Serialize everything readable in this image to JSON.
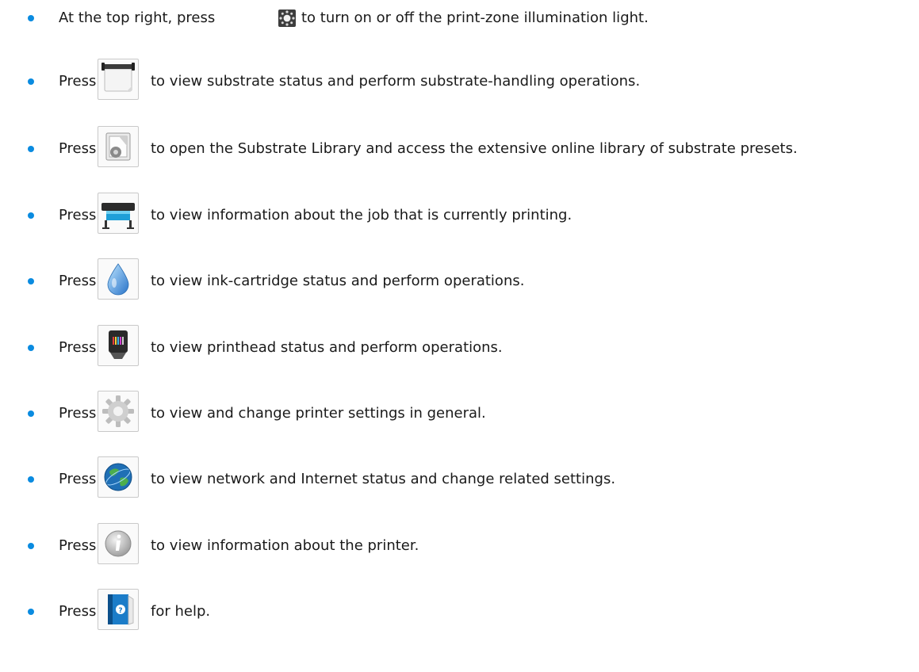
{
  "items": [
    {
      "lead": "At the top right, press",
      "icon": "sun-icon",
      "text": "to turn on or off the print-zone illumination light."
    },
    {
      "lead": "Press",
      "icon": "substrate-roll-icon",
      "text": "to view substrate status and perform substrate-handling operations."
    },
    {
      "lead": "Press",
      "icon": "substrate-library-icon",
      "text": "to open the Substrate Library and access the extensive online library of substrate presets."
    },
    {
      "lead": "Press",
      "icon": "printer-icon",
      "text": "to view information about the job that is currently printing."
    },
    {
      "lead": "Press",
      "icon": "ink-drop-icon",
      "text": "to view ink-cartridge status and perform operations."
    },
    {
      "lead": "Press",
      "icon": "printhead-icon",
      "text": "to view printhead status and perform operations."
    },
    {
      "lead": "Press",
      "icon": "gear-icon",
      "text": "to view and change printer settings in general."
    },
    {
      "lead": "Press",
      "icon": "globe-icon",
      "text": "to view network and Internet status and change related settings."
    },
    {
      "lead": "Press",
      "icon": "info-icon",
      "text": "to view information about the printer."
    },
    {
      "lead": "Press",
      "icon": "help-book-icon",
      "text": "for help."
    }
  ],
  "colors": {
    "bullet": "#0a8be0",
    "text": "#1a1a1a",
    "icon_border": "#c9c9c9"
  }
}
